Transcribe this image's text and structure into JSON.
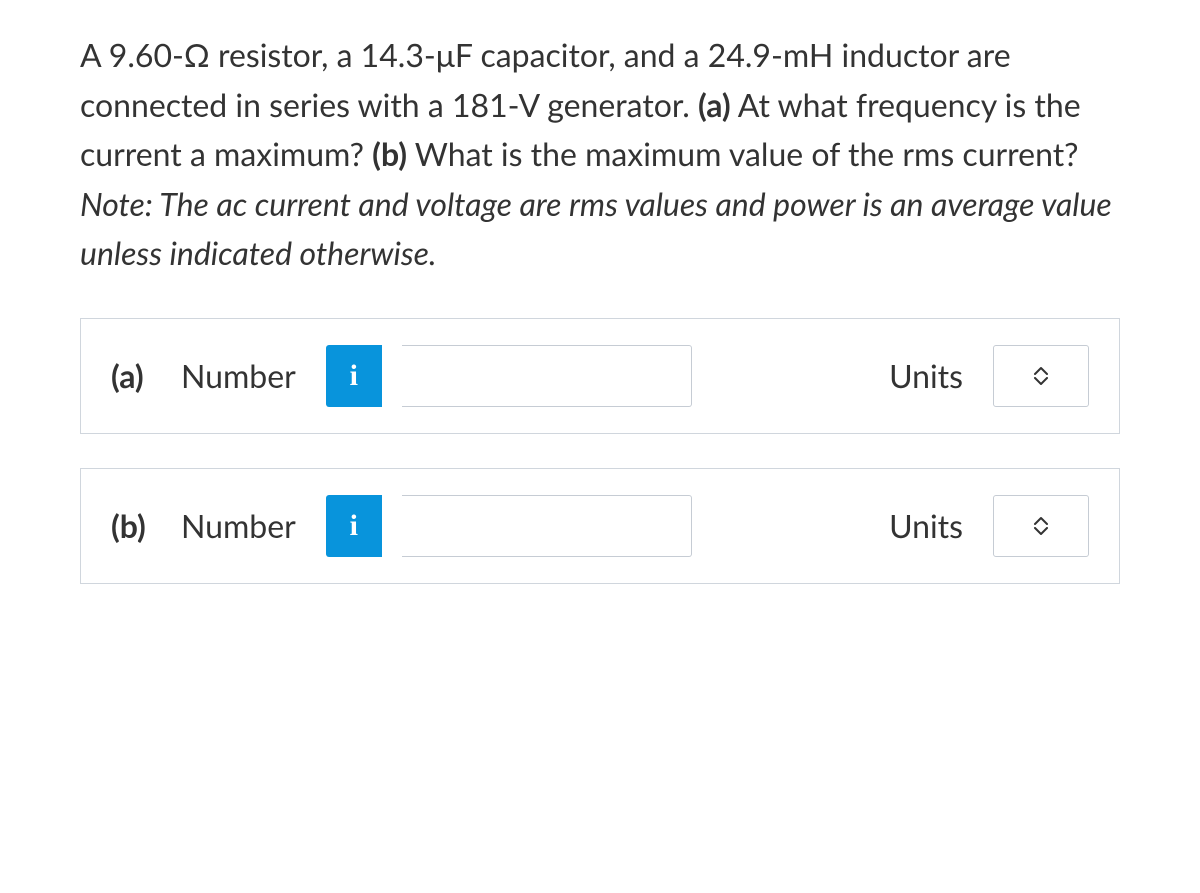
{
  "question": {
    "t1": "A 9.60-Ω resistor, a 14.3-μF capacitor, and a 24.9-mH inductor are connected in series with a 181-V generator. ",
    "b1": "(a)",
    "t2": " At what frequency is the current a maximum? ",
    "b2": "(b)",
    "t3": " What is the maximum value of the rms current? ",
    "i1": "Note: The ac current and voltage are rms values and power is an average value unless indicated otherwise."
  },
  "rows": {
    "a": {
      "part": "(a)",
      "number_label": "Number",
      "info": "i",
      "units_label": "Units",
      "value": ""
    },
    "b": {
      "part": "(b)",
      "number_label": "Number",
      "info": "i",
      "units_label": "Units",
      "value": ""
    }
  }
}
